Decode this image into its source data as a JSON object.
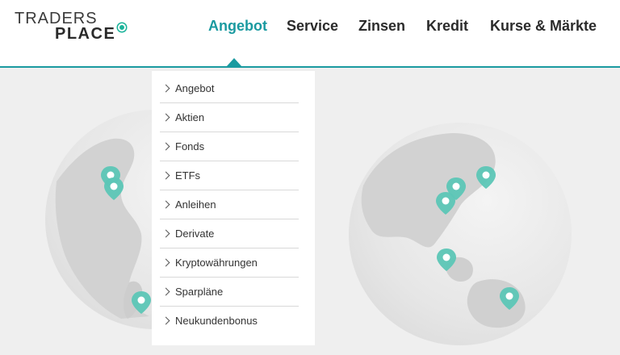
{
  "logo": {
    "line1": "TRADERS",
    "line2": "PLACE"
  },
  "nav": {
    "items": [
      {
        "label": "Angebot",
        "active": true
      },
      {
        "label": "Service",
        "active": false
      },
      {
        "label": "Zinsen",
        "active": false
      },
      {
        "label": "Kredit",
        "active": false
      },
      {
        "label": "Kurse & Märkte",
        "active": false
      }
    ]
  },
  "dropdown": {
    "items": [
      {
        "label": "Angebot"
      },
      {
        "label": "Aktien"
      },
      {
        "label": "Fonds"
      },
      {
        "label": "ETFs"
      },
      {
        "label": "Anleihen"
      },
      {
        "label": "Derivate"
      },
      {
        "label": "Kryptowährungen"
      },
      {
        "label": "Sparpläne"
      },
      {
        "label": "Neukundenbonus"
      }
    ]
  },
  "colors": {
    "accent": "#1a9aa0",
    "logo_dot": "#1bb39a",
    "marker": "#5cc6b6",
    "background": "#efefef"
  },
  "icons": {
    "map_marker": "map-pin-icon",
    "chevron": "chevron-right-icon",
    "globe": "globe-icon"
  }
}
